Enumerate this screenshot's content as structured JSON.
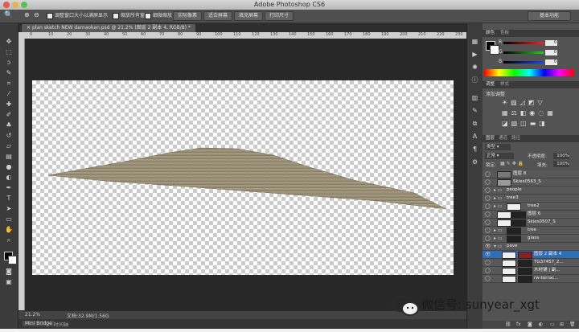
{
  "titlebar": {
    "title": "Adobe Photoshop CS6",
    "workspace": "基本功能"
  },
  "options": {
    "checkboxes": [
      "调整窗口大小以满屏显示",
      "缩放所有窗口",
      "细微缩放"
    ],
    "buttons": [
      "实际像素",
      "适合屏幕",
      "填充屏幕",
      "打印尺寸"
    ]
  },
  "document": {
    "tab": "plan sketch NEW damaokan.psd @ 21.2% (图层 2 副本 4, RGB/8) *"
  },
  "ruler_labels": [
    "0",
    "10",
    "20",
    "30",
    "40",
    "50",
    "60",
    "70",
    "80",
    "90",
    "100",
    "110",
    "120",
    "130",
    "140",
    "150",
    "160",
    "170",
    "180",
    "190",
    "200",
    "210",
    "220",
    "230",
    "240"
  ],
  "status": {
    "zoom": "21.2%",
    "doc_size": "文档:32.9M/1.56G"
  },
  "bridge": {
    "tab1": "Mini Bridge",
    "tab2": "时间轴"
  },
  "color_panel": {
    "tabs": [
      "颜色",
      "色板"
    ],
    "channels": [
      {
        "label": "R",
        "value": "0",
        "color": "#d83a3a"
      },
      {
        "label": "G",
        "value": "0",
        "color": "#3ab53a"
      },
      {
        "label": "B",
        "value": "0",
        "color": "#3a5ad8"
      }
    ]
  },
  "adjust_panel": {
    "tabs": [
      "调整",
      "样式"
    ],
    "heading": "添加调整"
  },
  "layers_panel": {
    "tabs": [
      "图层",
      "通道",
      "路径"
    ],
    "kind": "类型",
    "blend": "正常",
    "opacity_label": "不透明度:",
    "opacity": "100%",
    "lock_label": "锁定:",
    "fill_label": "填充:",
    "fill": "100%",
    "layers": [
      {
        "name": "图层 8",
        "type": "layer"
      },
      {
        "name": "Skies0563_S",
        "type": "layer"
      },
      {
        "name": "people",
        "type": "group"
      },
      {
        "name": "tree3",
        "type": "group"
      },
      {
        "name": "tree2",
        "type": "group"
      },
      {
        "name": "图层 6",
        "type": "layer"
      },
      {
        "name": "Skies0507_S",
        "type": "layer"
      },
      {
        "name": "tree",
        "type": "group"
      },
      {
        "name": "glass",
        "type": "group"
      },
      {
        "name": "pave",
        "type": "group"
      },
      {
        "name": "图层 2 副本 4",
        "type": "layer"
      },
      {
        "name": "TG37457_2...",
        "type": "layer"
      },
      {
        "name": "木材铺 | 副...",
        "type": "layer"
      },
      {
        "name": "rw-terrac...",
        "type": "layer"
      }
    ]
  },
  "watermark": {
    "text": "微信号: sunyear_xgt"
  },
  "colors": {
    "accent": "#2f6eb5",
    "panel_bg": "#535353",
    "canvas_bg": "#282828"
  }
}
